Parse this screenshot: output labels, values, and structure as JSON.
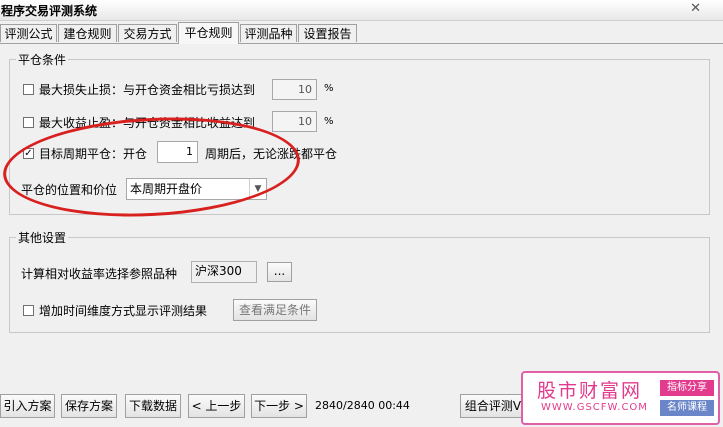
{
  "window": {
    "title": "程序交易评测系统",
    "close_glyph": "✕"
  },
  "tabs": [
    {
      "label": "评测公式"
    },
    {
      "label": "建仓规则"
    },
    {
      "label": "交易方式"
    },
    {
      "label": "平仓规则",
      "active": true
    },
    {
      "label": "评测品种"
    },
    {
      "label": "设置报告"
    }
  ],
  "close_conditions": {
    "title": "平仓条件",
    "max_loss": {
      "label": "最大损失止损：与开仓资金相比亏损达到",
      "value": "10",
      "unit": "%",
      "checked": false
    },
    "max_profit": {
      "label": "最大收益止盈：与开仓资金相比收益达到",
      "value": "10",
      "unit": "%",
      "checked": false
    },
    "target_period": {
      "label": "目标周期平仓：开仓",
      "value": "1",
      "suffix": "周期后，无论涨跌都平仓",
      "checked": true,
      "check_glyph": "✓"
    },
    "position_price": {
      "label": "平仓的位置和价位",
      "selected": "本周期开盘价"
    }
  },
  "other_settings": {
    "title": "其他设置",
    "benchmark": {
      "label": "计算相对收益率选择参照品种",
      "value": "沪深300",
      "browse_label": "..."
    },
    "time_dimension": {
      "label": "增加时间维度方式显示评测结果",
      "checked": false,
      "view_button": "查看满足条件"
    }
  },
  "bottom": {
    "import": "引入方案",
    "save": "保存方案",
    "download": "下载数据",
    "prev": "< 上一步",
    "next": "下一步 >",
    "status": "2840/2840 00:44",
    "combo": "组合评测V"
  },
  "watermark": {
    "brand": "股市财富网",
    "site": "WWW.GSCFW.COM",
    "tag1": "指标分享",
    "tag2": "名师课程"
  },
  "colors": {
    "annotation": "#d8201e",
    "watermark": "#e23b8d",
    "watermark_tag2": "#6b86c8"
  }
}
